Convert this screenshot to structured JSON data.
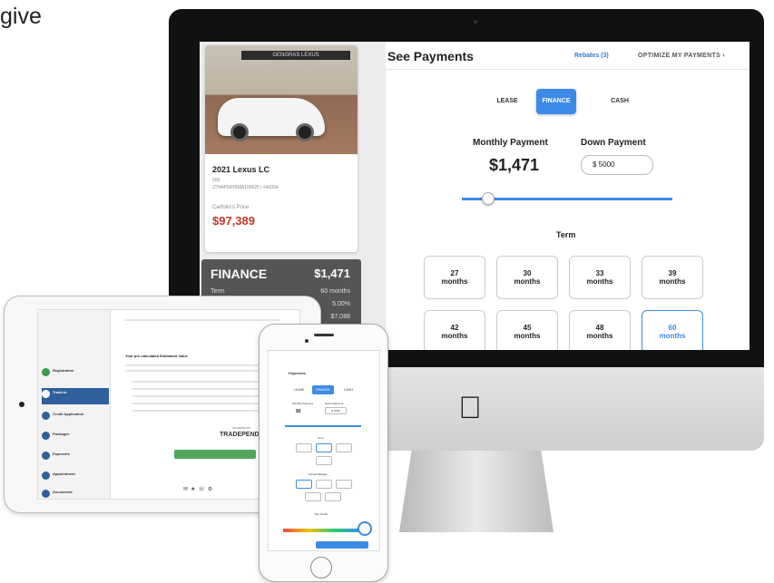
{
  "corner_text": "give",
  "imac": {
    "car": {
      "title": "2021 Lexus LC",
      "trim": "500",
      "vin": "JTHAP5AY8MA100025 | #44394",
      "price_label": "Carfolio's Price",
      "price": "$97,389",
      "dealer": "GENGRAS LEXUS"
    },
    "finance_panel": {
      "title": "FINANCE",
      "amount": "$1,471",
      "rows": [
        {
          "label": "Term",
          "value": "60 months"
        },
        {
          "label": "",
          "value": "5.00%"
        },
        {
          "label": "",
          "value": "$7,088"
        }
      ]
    },
    "header": {
      "title": "See Payments",
      "rebates": "Rebates (3)",
      "optimize": "OPTIMIZE MY PAYMENTS"
    },
    "tabs": [
      "LEASE",
      "FINANCE",
      "CASH"
    ],
    "active_tab": "FINANCE",
    "monthly_payment_label": "Monthly Payment",
    "monthly_payment_value": "$1,471",
    "down_payment_label": "Down Payment",
    "down_payment_value": "$ 5000",
    "term_label": "Term",
    "terms": [
      {
        "num": "27",
        "unit": "months"
      },
      {
        "num": "30",
        "unit": "months"
      },
      {
        "num": "33",
        "unit": "months"
      },
      {
        "num": "39",
        "unit": "months"
      },
      {
        "num": "42",
        "unit": "months"
      },
      {
        "num": "45",
        "unit": "months"
      },
      {
        "num": "48",
        "unit": "months"
      },
      {
        "num": "60",
        "unit": "months"
      }
    ],
    "selected_term": "60"
  },
  "ipad": {
    "powered_by": "POWERED BY",
    "brand": "TRADEPENDING",
    "section_title": "Your pre-calculated Estimated Value",
    "steps": [
      "Registration",
      "Trade-In",
      "Credit Application",
      "Packages",
      "Payments",
      "Appointment",
      "Documents"
    ]
  },
  "iphone": {
    "header": "Payments",
    "tabs": [
      "LEASE",
      "FINANCE",
      "CASH"
    ],
    "monthly_label": "Monthly Payment",
    "monthly_value": "$0",
    "down_label": "Down Payment",
    "down_value": "$ 3000",
    "term_label": "Term",
    "mileage_label": "Annual Mileage",
    "credit_label": "Your Credit"
  },
  "colors": {
    "accent": "#3d8be6",
    "price_red": "#c0392b",
    "panel_gray": "#555555"
  }
}
